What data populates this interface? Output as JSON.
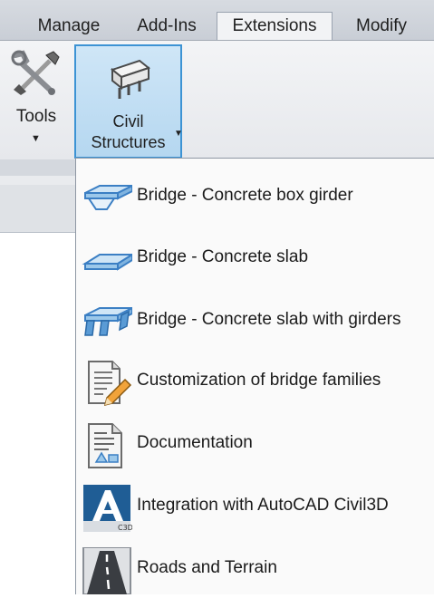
{
  "tabs": [
    {
      "label": "Manage",
      "active": false
    },
    {
      "label": "Add-Ins",
      "active": false
    },
    {
      "label": "Extensions",
      "active": true
    },
    {
      "label": "Modify",
      "active": false
    }
  ],
  "ribbon": {
    "tools": {
      "label": "Tools",
      "icon": "wrench-screwdriver-icon"
    },
    "civil_structures": {
      "line1": "Civil",
      "line2": "Structures",
      "icon": "bridge-deck-icon"
    }
  },
  "menu": {
    "items": [
      {
        "label": "Bridge - Concrete box girder",
        "icon": "box-girder-icon"
      },
      {
        "label": "Bridge - Concrete slab",
        "icon": "concrete-slab-icon"
      },
      {
        "label": "Bridge - Concrete slab with girders",
        "icon": "slab-girders-icon"
      },
      {
        "label": "Customization of bridge families",
        "icon": "document-edit-icon"
      },
      {
        "label": "Documentation",
        "icon": "documentation-icon"
      },
      {
        "label": "Integration with AutoCAD Civil3D",
        "icon": "civil3d-icon"
      },
      {
        "label": "Roads and Terrain",
        "icon": "road-icon"
      }
    ]
  },
  "colors": {
    "accent": "#3c93d4",
    "button_highlight": "#cfe6f7",
    "ribbon_bg": "#eceef1",
    "tab_bg": "#cfd4db"
  }
}
